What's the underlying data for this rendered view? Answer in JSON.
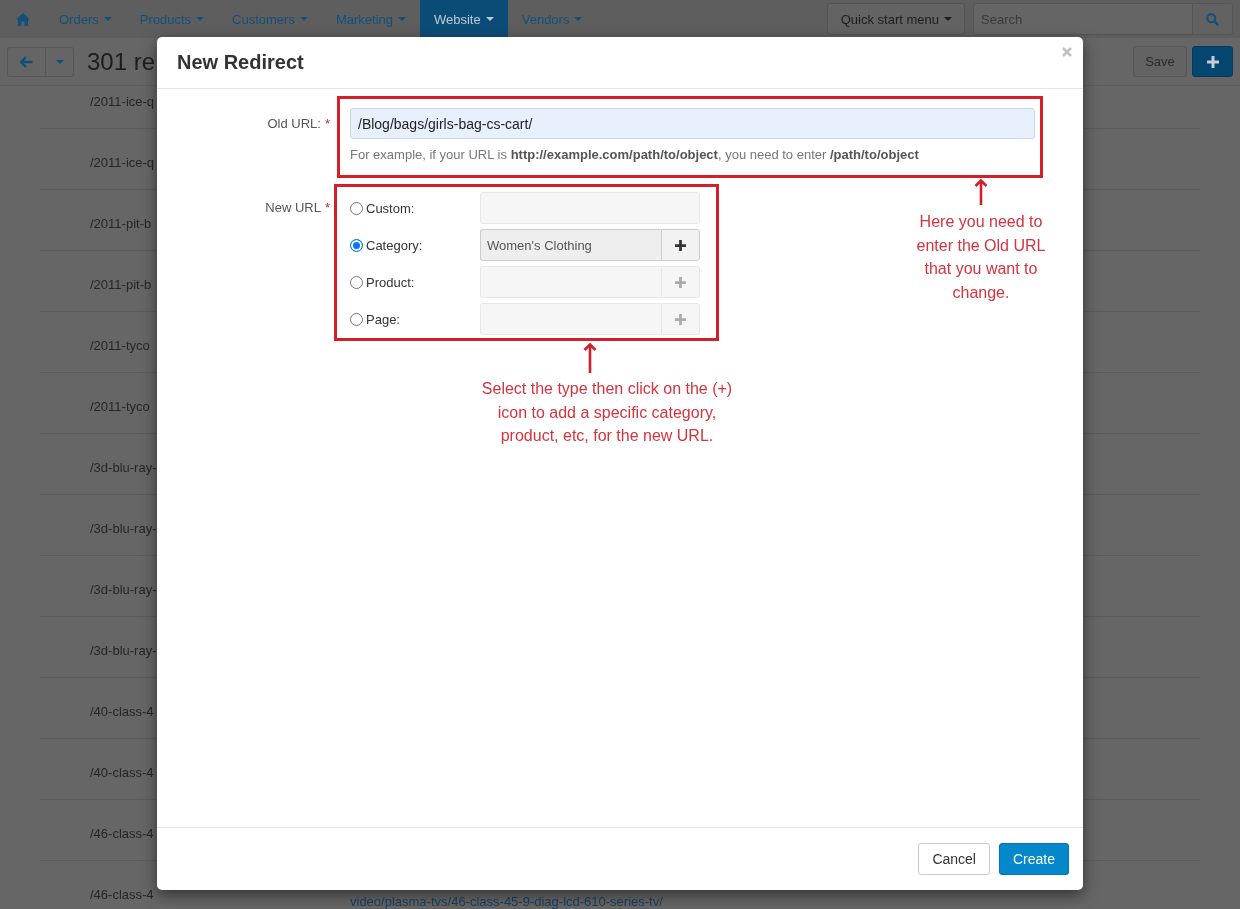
{
  "top_nav": {
    "items": [
      {
        "label": "Orders",
        "selected": false
      },
      {
        "label": "Products",
        "selected": false
      },
      {
        "label": "Customers",
        "selected": false
      },
      {
        "label": "Marketing",
        "selected": false
      },
      {
        "label": "Website",
        "selected": true
      },
      {
        "label": "Vendors",
        "selected": false
      }
    ],
    "quick_start_menu": "Quick start menu",
    "search": {
      "placeholder": "Search"
    }
  },
  "page_header": {
    "title": "301 re",
    "save_button": "Save"
  },
  "background_table": {
    "rows": [
      {
        "column_1": "/2011-ice-q"
      },
      {
        "column_1": "/2011-ice-q"
      },
      {
        "column_1": "/2011-pit-b"
      },
      {
        "column_1": "/2011-pit-b"
      },
      {
        "column_1": "/2011-tyco"
      },
      {
        "column_1": "/2011-tyco"
      },
      {
        "column_1": "/3d-blu-ray-"
      },
      {
        "column_1": "/3d-blu-ray-"
      },
      {
        "column_1": "/3d-blu-ray-"
      },
      {
        "column_1": "/3d-blu-ray-"
      },
      {
        "column_1": "/40-class-4"
      },
      {
        "column_1": "/40-class-4"
      },
      {
        "column_1": "/46-class-4"
      },
      {
        "column_1": "/46-class-4",
        "column_2": "video/plasma-tvs/46-class-45-9-diag-lcd-610-series-tv/"
      }
    ]
  },
  "dialog": {
    "title": "New Redirect",
    "old_url": {
      "label": "Old URL:",
      "required_mark": "*",
      "value": "/Blog/bags/girls-bag-cs-cart/",
      "help": "For example, if your URL is **http://example.com/path/to/object**, you need to enter **/path/to/object**"
    },
    "new_url": {
      "label": "New URL",
      "required_mark": "*",
      "options": [
        {
          "label": "Custom:",
          "kind": "text",
          "selected": false
        },
        {
          "label": "Category:",
          "kind": "picker",
          "selected": true,
          "value": "Women's Clothing"
        },
        {
          "label": "Product:",
          "kind": "picker",
          "selected": false
        },
        {
          "label": "Page:",
          "kind": "picker",
          "selected": false
        }
      ]
    },
    "annotations": [
      {
        "text": "Here you need to\nenter the Old URL\nthat you want to\nchange."
      },
      {
        "text": "Select the type then click on the (+)\nicon to add a specific category,\nproduct, etc, for the new URL."
      }
    ],
    "buttons": [
      {
        "label": "Cancel",
        "kind": "secondary"
      },
      {
        "label": "Create",
        "kind": "primary"
      }
    ]
  }
}
